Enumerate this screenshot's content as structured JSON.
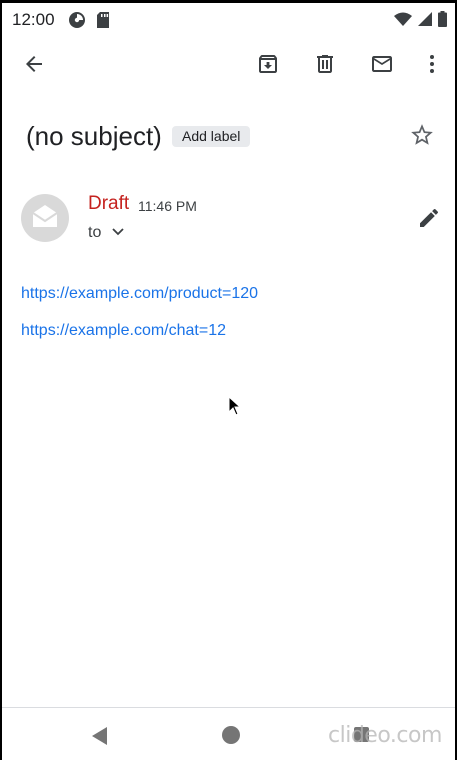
{
  "status_bar": {
    "time": "12:00",
    "icons_left": [
      "data-saver-icon",
      "sd-card-icon"
    ],
    "icons_right": [
      "wifi-icon",
      "cellular-icon",
      "battery-icon"
    ]
  },
  "toolbar": {
    "icons": [
      "back-arrow-icon",
      "archive-icon",
      "delete-icon",
      "mark-unread-icon",
      "more-vert-icon"
    ]
  },
  "message": {
    "subject": "(no subject)",
    "add_label": "Add label",
    "draft_label": "Draft",
    "time": "11:46 PM",
    "to_label": "to",
    "links": [
      "https://example.com/product=120",
      "https://example.com/chat=12"
    ]
  },
  "colors": {
    "draft": "#c5221f",
    "link": "#1a73e8",
    "chip": "#e8eaed"
  },
  "watermark": "clideo.com"
}
